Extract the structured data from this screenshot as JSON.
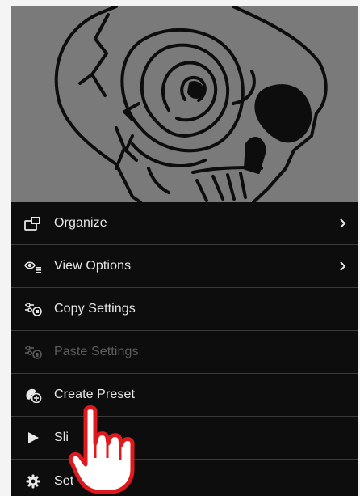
{
  "menu": {
    "items": [
      {
        "label": "Organize",
        "icon": "organize-icon",
        "has_submenu": true,
        "enabled": true
      },
      {
        "label": "View Options",
        "icon": "view-options-icon",
        "has_submenu": true,
        "enabled": true
      },
      {
        "label": "Copy Settings",
        "icon": "copy-settings-icon",
        "has_submenu": false,
        "enabled": true
      },
      {
        "label": "Paste Settings",
        "icon": "paste-settings-icon",
        "has_submenu": false,
        "enabled": false
      },
      {
        "label": "Create Preset",
        "icon": "create-preset-icon",
        "has_submenu": false,
        "enabled": true
      },
      {
        "label": "Sli",
        "icon": "play-icon",
        "has_submenu": false,
        "enabled": true
      },
      {
        "label": "Set",
        "icon": "gear-icon",
        "has_submenu": false,
        "enabled": true
      }
    ]
  },
  "colors": {
    "menu_background": "#0d0d0d",
    "photo_background": "#7a7a7a",
    "text": "#e8e8e8",
    "disabled_text": "#5c5c5c",
    "divider": "#3a3a3a",
    "cursor_fill": "#ffffff",
    "cursor_outline": "#e0191d"
  }
}
